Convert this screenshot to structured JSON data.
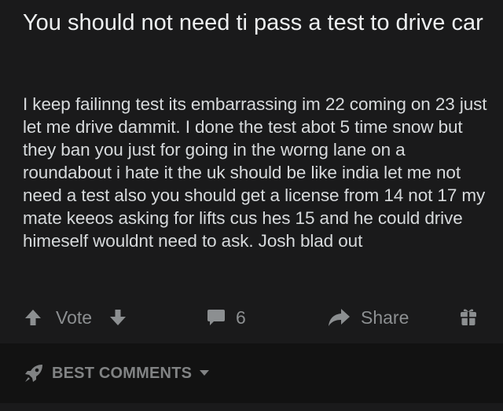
{
  "post": {
    "title": "You should not need ti pass a test to drive car",
    "body": "I keep failinng test its embarrassing im 22 coming on 23 just let me drive dammit. I done the test abot 5 time snow but they ban you just for going in the worng lane on a roundabout i hate it the uk should be like india let me not need a test also you should get a license from 14 not 17 my mate keeos asking for lifts cus hes 15 and he could drive himeself wouldnt need to ask. Josh blad out"
  },
  "actions": {
    "vote_label": "Vote",
    "comment_count": "6",
    "share_label": "Share",
    "upvote_icon": "arrow-up-icon",
    "downvote_icon": "arrow-down-icon",
    "comment_icon": "comment-bubble-icon",
    "share_icon": "share-arrow-icon",
    "award_icon": "gift-icon",
    "icon_color": "#8c8f91"
  },
  "comments_bar": {
    "sort_label": "BEST COMMENTS",
    "sort_icon": "rocket-icon",
    "caret_icon": "chevron-down-icon"
  },
  "colors": {
    "background": "#1a1a1b",
    "comments_bar_background": "#121212",
    "title_text": "#eef0f1",
    "body_text": "#d7dadc"
  }
}
